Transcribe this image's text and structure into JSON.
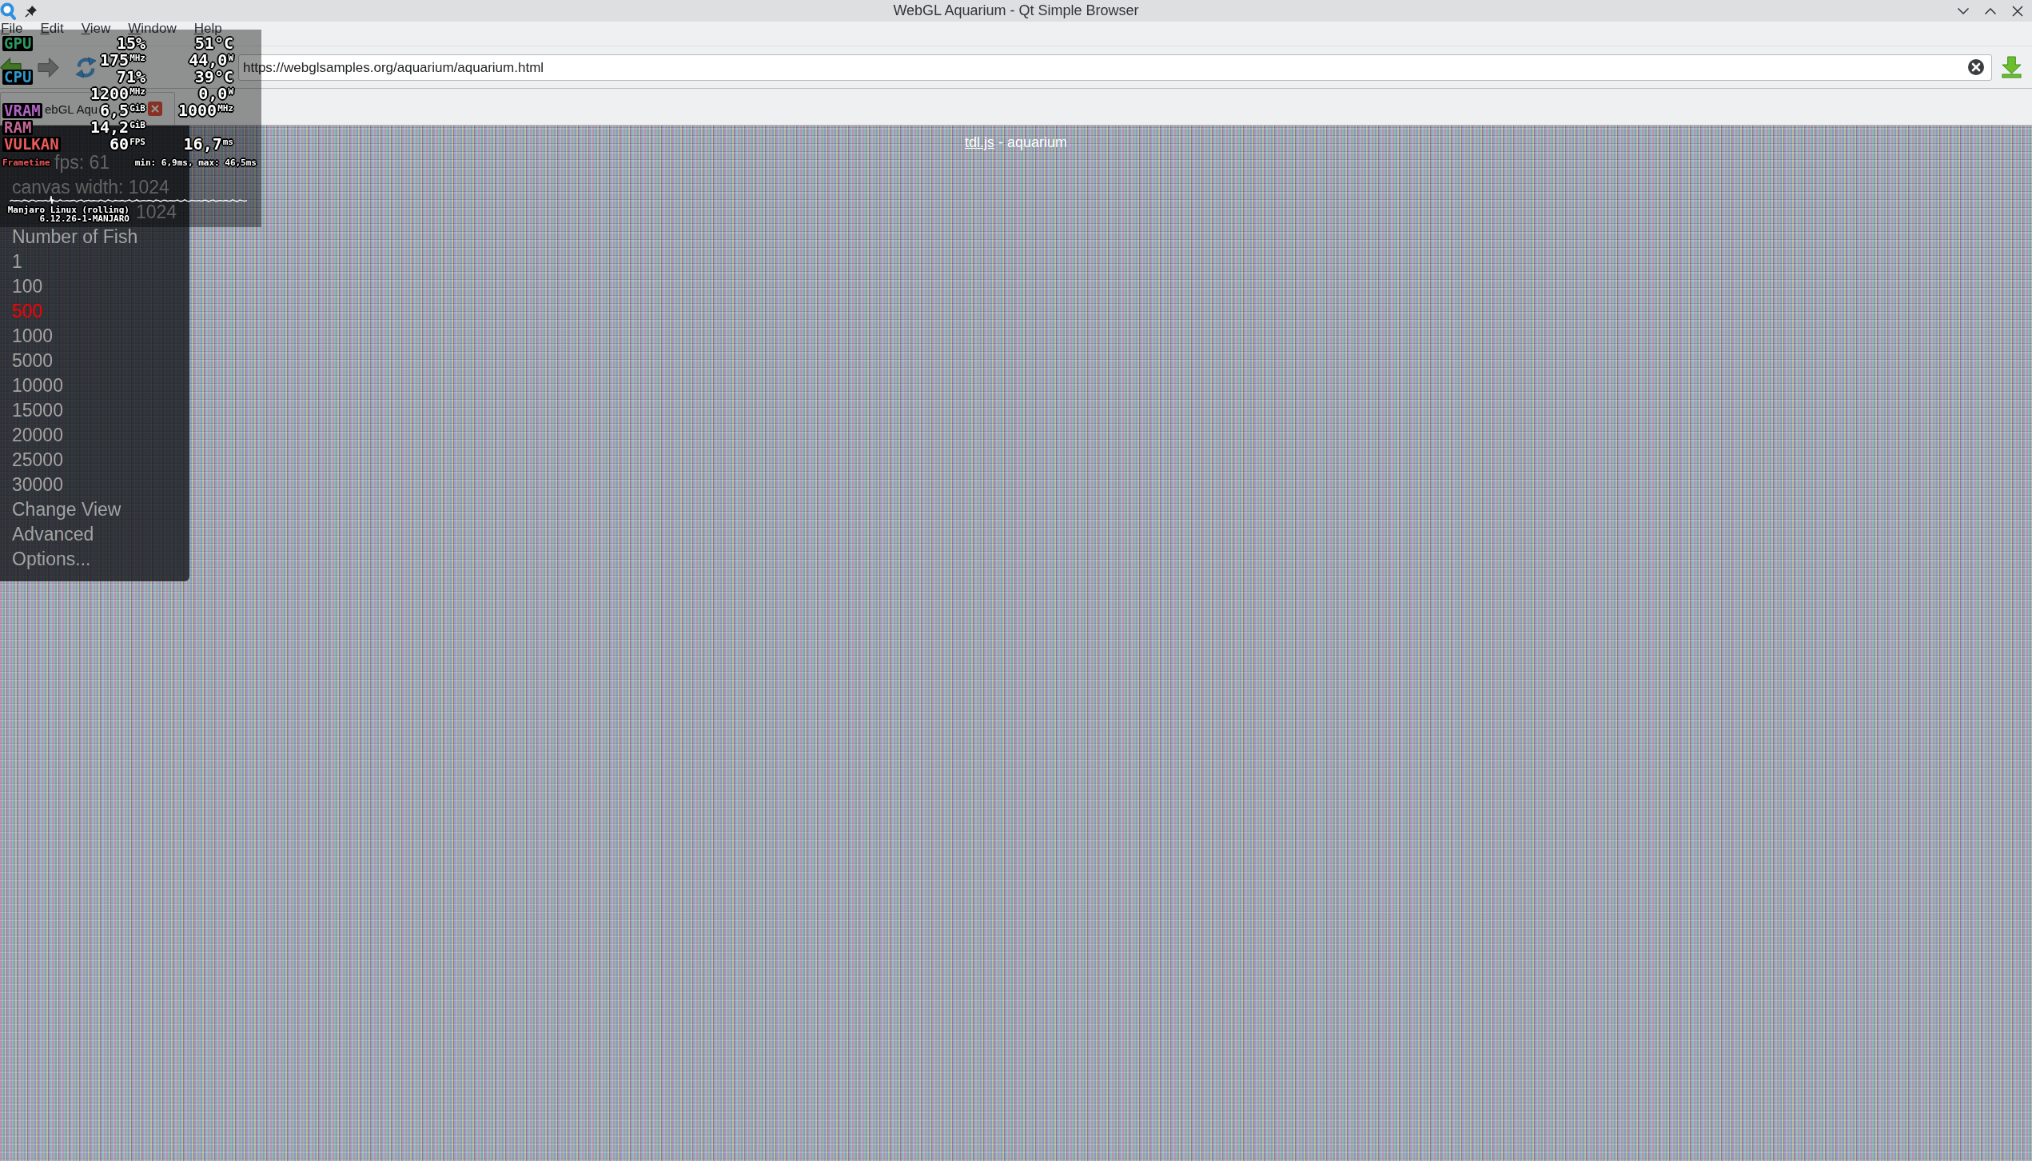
{
  "window": {
    "title": "WebGL Aquarium - Qt Simple Browser"
  },
  "menu_bar": [
    "File",
    "Edit",
    "View",
    "Window",
    "Help"
  ],
  "toolbar": {
    "buttons": [
      {
        "kind": "back",
        "disabled": false
      },
      {
        "kind": "forward",
        "disabled": true
      },
      {
        "kind": "reload",
        "disabled": false
      }
    ],
    "address": "https://webglsamples.org/aquarium/aquarium.html"
  },
  "tabs": [
    {
      "label": "ebGL Aqu",
      "selected": true
    }
  ],
  "page": {
    "header": {
      "link": "tdl.js",
      "text": "- aquarium"
    },
    "info": [
      "fps: 61",
      "canvas width: 1024",
      "1024"
    ],
    "fish_heading": "Number of Fish",
    "fish_counts": [
      {
        "label": "1",
        "selected": false
      },
      {
        "label": "100",
        "selected": false
      },
      {
        "label": "500",
        "selected": true
      },
      {
        "label": "1000",
        "selected": false
      },
      {
        "label": "5000",
        "selected": false
      },
      {
        "label": "10000",
        "selected": false
      },
      {
        "label": "15000",
        "selected": false
      },
      {
        "label": "20000",
        "selected": false
      },
      {
        "label": "25000",
        "selected": false
      },
      {
        "label": "30000",
        "selected": false
      }
    ],
    "actions": [
      "Change View",
      "Advanced",
      "Options..."
    ]
  },
  "hud": {
    "groups": [
      {
        "kind": "gpu",
        "label": "GPU",
        "lines": [
          [
            "15%",
            "51°C"
          ],
          [
            "175$^{MHz}$",
            "44,0$^{W}$"
          ]
        ]
      },
      {
        "kind": "cpu",
        "label": "CPU",
        "lines": [
          [
            "71%",
            "39°C"
          ],
          [
            "1200$^{MHz}$",
            "0,0$^{W}$"
          ]
        ]
      },
      {
        "kind": "vram",
        "label": "VRAM",
        "lines": [
          [
            "6,5$^{GiB}$",
            "1000$^{MHz}$"
          ]
        ]
      },
      {
        "kind": "ram",
        "label": "RAM",
        "lines": [
          [
            "14,2$^{GiB}$"
          ]
        ]
      },
      {
        "kind": "engine",
        "label": "VULKAN",
        "lines": [
          [
            "60$^{FPS}$",
            "16,7$^{ms}$"
          ]
        ]
      }
    ],
    "frametime": {
      "label": "Frametime",
      "stats": "min: 6,9ms, max: 46,5ms"
    },
    "system": [
      "Manjaro Linux (rolling)",
      "6.12.26-1-MANJARO"
    ]
  }
}
